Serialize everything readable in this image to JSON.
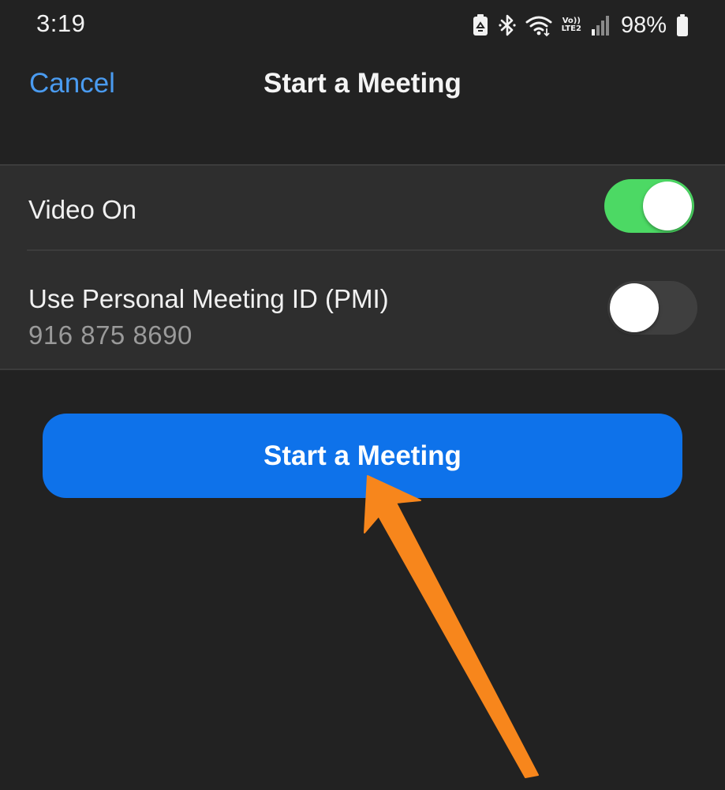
{
  "status_bar": {
    "time": "3:19",
    "network_top": "Vo))",
    "network_bottom": "LTE2",
    "battery_percent": "98%",
    "icons": [
      "recycle-icon",
      "bluetooth-icon",
      "wifi-icon",
      "volte-icon",
      "signal-icon",
      "battery-icon"
    ]
  },
  "nav": {
    "cancel_label": "Cancel",
    "title": "Start a Meeting"
  },
  "settings": {
    "video": {
      "label": "Video On",
      "enabled": true
    },
    "pmi": {
      "label": "Use Personal Meeting ID (PMI)",
      "meeting_id": "916 875 8690",
      "enabled": false
    }
  },
  "start_button": {
    "label": "Start a Meeting"
  },
  "colors": {
    "background": "#222222",
    "group_background": "#2e2e2e",
    "accent_blue": "#0e72ea",
    "link_blue": "#4a9bf0",
    "toggle_on": "#4cd964",
    "toggle_off": "#3f3f3f",
    "annotation_arrow": "#f7861c"
  }
}
